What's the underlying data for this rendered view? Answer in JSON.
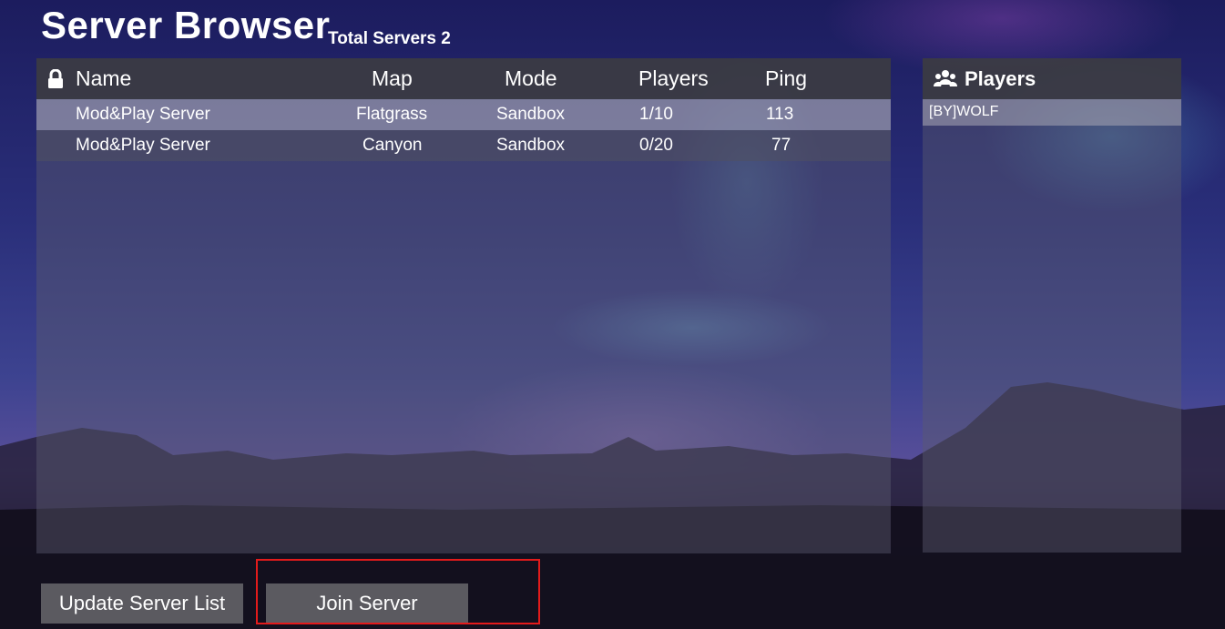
{
  "title": "Server Browser",
  "subtitle": "Total Servers 2",
  "server_list": {
    "columns": {
      "name": "Name",
      "map": "Map",
      "mode": "Mode",
      "players": "Players",
      "ping": "Ping"
    },
    "rows": [
      {
        "name": "Mod&Play Server",
        "map": "Flatgrass",
        "mode": "Sandbox",
        "players": "1/10",
        "ping": "113",
        "selected": true
      },
      {
        "name": "Mod&Play Server",
        "map": "Canyon",
        "mode": "Sandbox",
        "players": "0/20",
        "ping": "77",
        "selected": false
      }
    ]
  },
  "players_panel": {
    "title": "Players",
    "players": [
      "[BY]WOLF"
    ]
  },
  "buttons": {
    "update": "Update Server List",
    "join": "Join Server"
  },
  "icons": {
    "lock": "lock-icon",
    "players": "group-icon"
  },
  "colors": {
    "highlight": "#e31b1b"
  }
}
